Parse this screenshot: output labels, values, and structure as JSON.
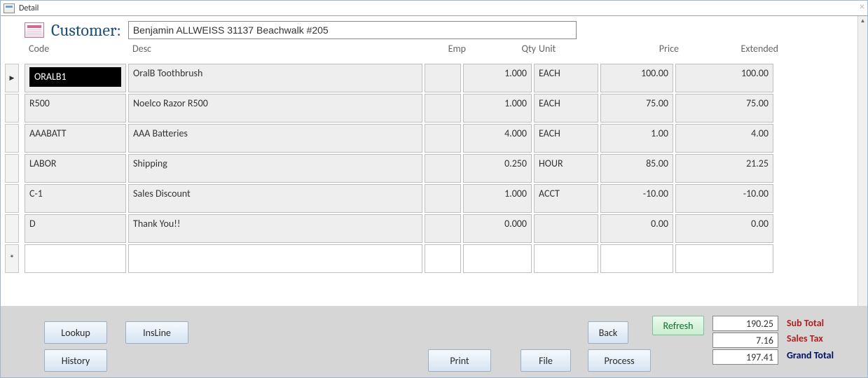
{
  "window": {
    "title": "Detail"
  },
  "header": {
    "customer_label": "Customer:",
    "customer_value": "Benjamin ALLWEISS 31137 Beachwalk #205"
  },
  "columns": {
    "code": "Code",
    "desc": "Desc",
    "emp": "Emp",
    "qty": "Qty",
    "unit": "Unit",
    "price": "Price",
    "extended": "Extended"
  },
  "rows": [
    {
      "code": "ORALB1",
      "desc": "OralB Toothbrush",
      "emp": "",
      "qty": "1.000",
      "unit": "EACH",
      "price": "100.00",
      "ext": "100.00",
      "current": true,
      "white": false
    },
    {
      "code": "R500",
      "desc": "Noelco Razor R500",
      "emp": "",
      "qty": "1.000",
      "unit": "EACH",
      "price": "75.00",
      "ext": "75.00"
    },
    {
      "code": "AAABATT",
      "desc": "AAA Batteries",
      "emp": "",
      "qty": "4.000",
      "unit": "EACH",
      "price": "1.00",
      "ext": "4.00"
    },
    {
      "code": "LABOR",
      "desc": "Shipping",
      "emp": "",
      "qty": "0.250",
      "unit": "HOUR",
      "price": "85.00",
      "ext": "21.25"
    },
    {
      "code": "C-1",
      "desc": "Sales Discount",
      "emp": "",
      "qty": "1.000",
      "unit": "ACCT",
      "price": "-10.00",
      "ext": "-10.00"
    },
    {
      "code": "D",
      "desc": "Thank You!!",
      "emp": "",
      "qty": "0.000",
      "unit": "",
      "price": "0.00",
      "ext": "0.00"
    },
    {
      "code": "",
      "desc": "",
      "emp": "",
      "qty": "",
      "unit": "",
      "price": "",
      "ext": "",
      "new": true,
      "white": true
    }
  ],
  "footer": {
    "buttons": {
      "lookup": "Lookup",
      "insline": "InsLine",
      "history": "History",
      "print": "Print",
      "file": "File",
      "back": "Back",
      "refresh": "Refresh",
      "process": "Process"
    },
    "totals": {
      "subtotal_label": "Sub Total",
      "subtotal_value": "190.25",
      "salestax_label": "Sales Tax",
      "salestax_value": "7.16",
      "grandtotal_label": "Grand Total",
      "grandtotal_value": "197.41"
    }
  }
}
